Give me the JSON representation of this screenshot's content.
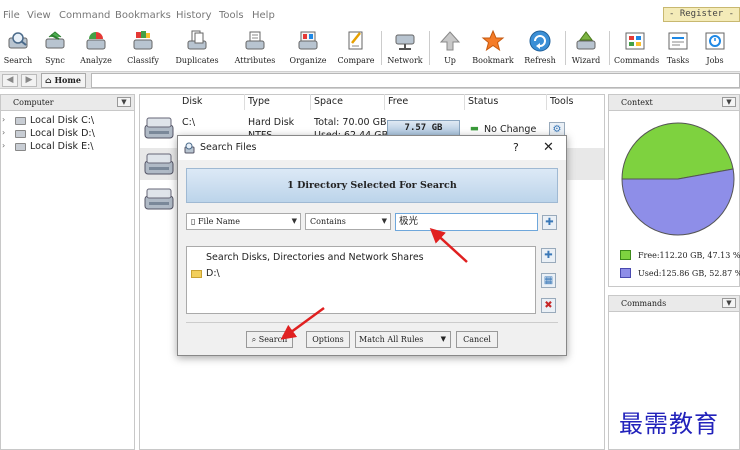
{
  "menu": [
    "File",
    "View",
    "Command",
    "Bookmarks",
    "History",
    "Tools",
    "Help"
  ],
  "register_label": "- Register -",
  "toolbar": [
    {
      "label": "Search",
      "icon": "search-icon"
    },
    {
      "label": "Sync",
      "icon": "sync-icon"
    },
    {
      "label": "Analyze",
      "icon": "analyze-icon"
    },
    {
      "label": "Classify",
      "icon": "classify-icon"
    },
    {
      "label": "Duplicates",
      "icon": "duplicates-icon"
    },
    {
      "label": "Attributes",
      "icon": "attributes-icon"
    },
    {
      "label": "Organize",
      "icon": "organize-icon"
    },
    {
      "label": "Compare",
      "icon": "compare-icon"
    },
    {
      "label": "Network",
      "icon": "network-icon"
    },
    {
      "label": "Up",
      "icon": "up-arrow-icon"
    },
    {
      "label": "Bookmark",
      "icon": "bookmark-star-icon"
    },
    {
      "label": "Refresh",
      "icon": "refresh-icon"
    },
    {
      "label": "Wizard",
      "icon": "wizard-icon"
    },
    {
      "label": "Commands",
      "icon": "commands-icon"
    },
    {
      "label": "Tasks",
      "icon": "tasks-icon"
    },
    {
      "label": "Jobs",
      "icon": "jobs-icon"
    }
  ],
  "nav": {
    "home_label": "Home",
    "back_icon": "back-arrow-icon",
    "forward_icon": "forward-arrow-icon"
  },
  "computer_panel": {
    "title": "Computer",
    "items": [
      {
        "label": "Local Disk C:\\"
      },
      {
        "label": "Local Disk D:\\"
      },
      {
        "label": "Local Disk E:\\"
      }
    ]
  },
  "disk_table": {
    "columns": [
      "Disk",
      "Type",
      "Space",
      "Free",
      "Status",
      "Tools"
    ],
    "row": {
      "disk": "C:\\",
      "type": "Hard Disk",
      "type2": "NTFS",
      "space": "Total: 70.00 GB",
      "space2": "Used: 62.44 GB",
      "free": "7.57 GB",
      "status": "No Change"
    }
  },
  "context_panel": {
    "title": "Context",
    "free_percent": 47.13,
    "used_percent": 52.87,
    "free_label": "Free:112.20 GB, 47.13 %",
    "used_label": "Used:125.86 GB, 52.87 %",
    "free_color": "#7ed23f",
    "used_color": "#8e8ee8"
  },
  "commands_panel": {
    "title": "Commands"
  },
  "dialog": {
    "title": "Search Files",
    "help": "?",
    "close": "✕",
    "banner": "1 Directory Selected For Search",
    "field_select": "File Name",
    "op_select": "Contains",
    "search_text": "极光",
    "list_header": "Search Disks, Directories and Network Shares",
    "list_item": "D:\\",
    "buttons": {
      "search": "Search",
      "options": "Options",
      "match": "Match All Rules",
      "cancel": "Cancel"
    }
  },
  "watermark": "最需教育"
}
